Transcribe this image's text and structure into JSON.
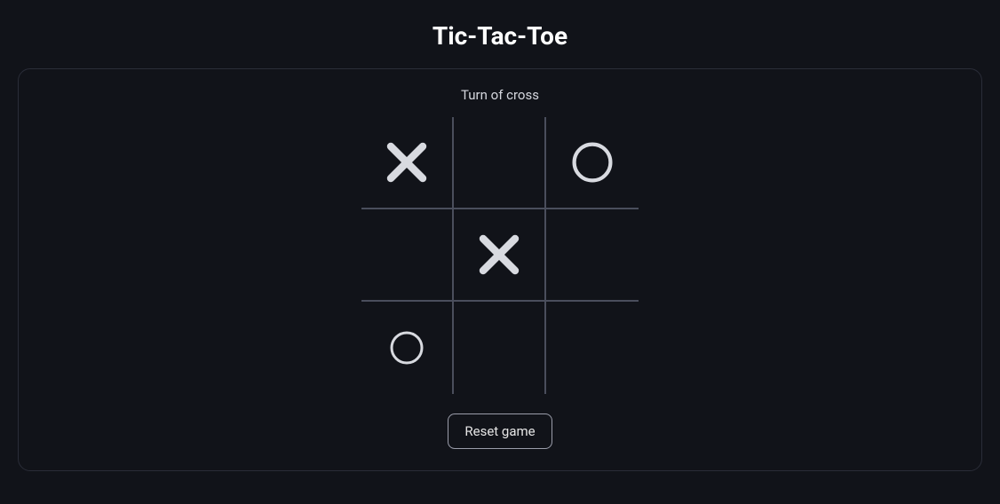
{
  "title": "Tic-Tac-Toe",
  "status": "Turn of cross",
  "reset_label": "Reset game",
  "board": {
    "cells": [
      "X",
      "",
      "O",
      "",
      "X",
      "",
      "O",
      "",
      ""
    ]
  },
  "icons": {
    "X": "x-mark-icon",
    "O": "o-mark-icon"
  }
}
